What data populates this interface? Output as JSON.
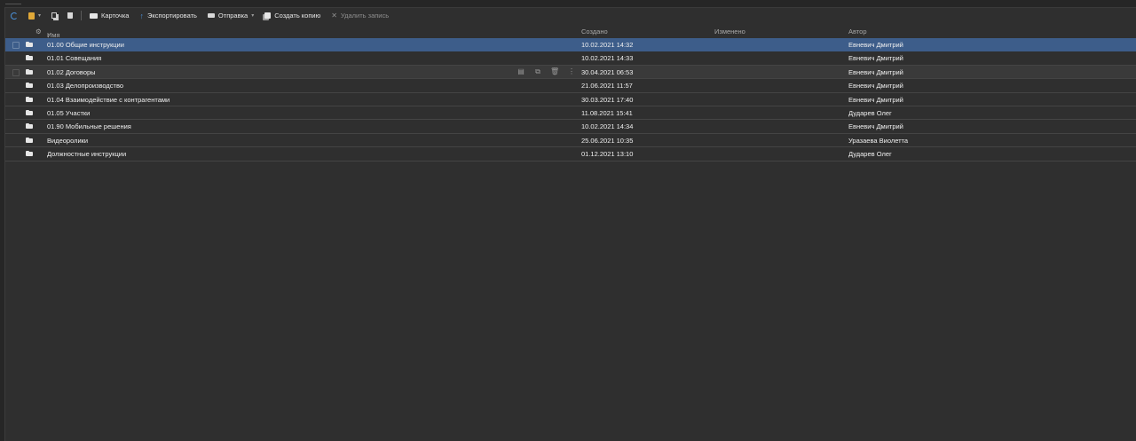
{
  "toolbar": {
    "card_label": "Карточка",
    "export_label": "Экспортировать",
    "send_label": "Отправка",
    "copy_label": "Создать копию",
    "delete_label": "Удалить запись"
  },
  "columns": {
    "name": "Имя",
    "sort_indicator": "↑",
    "created": "Создано",
    "modified": "Изменено",
    "author": "Автор"
  },
  "rows": [
    {
      "name": "01.00 Общие инструкции",
      "created": "10.02.2021 14:32",
      "modified": "",
      "author": "Евневич Дмитрий",
      "state": "selected"
    },
    {
      "name": "01.01 Совещания",
      "created": "10.02.2021 14:33",
      "modified": "",
      "author": "Евневич Дмитрий",
      "state": "normal"
    },
    {
      "name": "01.02 Договоры",
      "created": "30.04.2021 06:53",
      "modified": "",
      "author": "Евневич Дмитрий",
      "state": "hover"
    },
    {
      "name": "01.03 Делопроизводство",
      "created": "21.06.2021 11:57",
      "modified": "",
      "author": "Евневич Дмитрий",
      "state": "normal"
    },
    {
      "name": "01.04 Взаимодействие с контрагентами",
      "created": "30.03.2021 17:40",
      "modified": "",
      "author": "Евневич Дмитрий",
      "state": "normal"
    },
    {
      "name": "01.05 Участки",
      "created": "11.08.2021 15:41",
      "modified": "",
      "author": "Дударев Олег",
      "state": "normal"
    },
    {
      "name": "01.90 Мобильные решения",
      "created": "10.02.2021 14:34",
      "modified": "",
      "author": "Евневич Дмитрий",
      "state": "normal"
    },
    {
      "name": "Видеоролики",
      "created": "25.06.2021 10:35",
      "modified": "",
      "author": "Уразаева Виолетта",
      "state": "normal"
    },
    {
      "name": "Должностные инструкции",
      "created": "01.12.2021 13:10",
      "modified": "",
      "author": "Дударев Олег",
      "state": "normal"
    }
  ],
  "row_actions_icons": [
    "card-icon",
    "copy-icon",
    "trash-icon",
    "more-icon"
  ],
  "colors": {
    "background": "#2f2f2f",
    "selected_row": "#3d5d8a",
    "accent": "#4a8fd6",
    "new_doc_icon": "#e0a838"
  }
}
